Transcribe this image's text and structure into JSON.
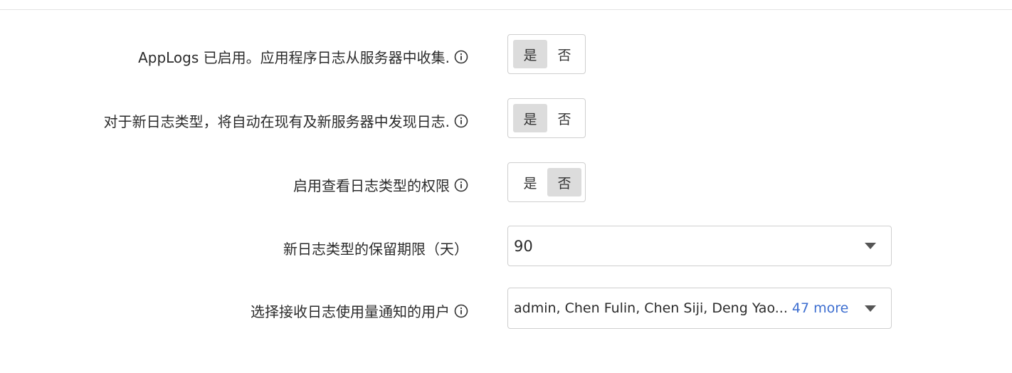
{
  "settings": [
    {
      "label": "AppLogs 已启用。应用程序日志从服务器中收集.",
      "type": "toggle",
      "yes": "是",
      "no": "否",
      "selected": "yes",
      "has_info": true
    },
    {
      "label": "对于新日志类型，将自动在现有及新服务器中发现日志.",
      "type": "toggle",
      "yes": "是",
      "no": "否",
      "selected": "yes",
      "has_info": true
    },
    {
      "label": "启用查看日志类型的权限",
      "type": "toggle",
      "yes": "是",
      "no": "否",
      "selected": "no",
      "has_info": true
    },
    {
      "label": "新日志类型的保留期限（天）",
      "type": "select",
      "value": "90",
      "has_info": false
    },
    {
      "label": "选择接收日志使用量通知的用户",
      "type": "multiselect",
      "value": "admin, Chen Fulin, Chen Siji, Deng Yao...",
      "more": "47 more",
      "has_info": true
    }
  ],
  "colors": {
    "selected_bg": "#dcdcdc",
    "border": "#cfcfcf",
    "link": "#3d6ed0"
  },
  "icons": {
    "info": "info-icon",
    "dropdown": "chevron-down-icon"
  }
}
